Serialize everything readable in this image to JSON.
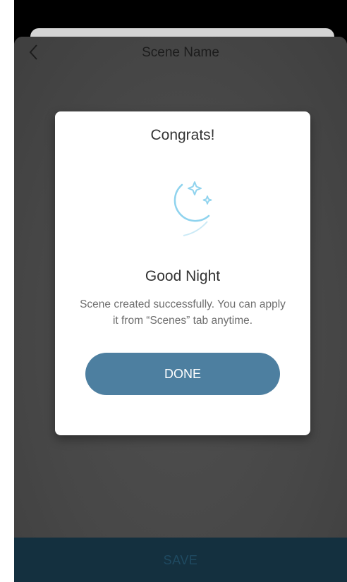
{
  "header": {
    "title": "Scene Name",
    "back_icon": "chevron-left-icon"
  },
  "dialog": {
    "title": "Congrats!",
    "icon": "moon-stars-icon",
    "scene_name": "Good Night",
    "message": "Scene created successfully. You can apply it from “Scenes” tab anytime.",
    "done_label": "DONE"
  },
  "footer": {
    "save_label": "SAVE"
  },
  "colors": {
    "done_button": "#4d7fa0",
    "save_bar": "#14303f",
    "icon_stroke": "#8fd3ee"
  }
}
